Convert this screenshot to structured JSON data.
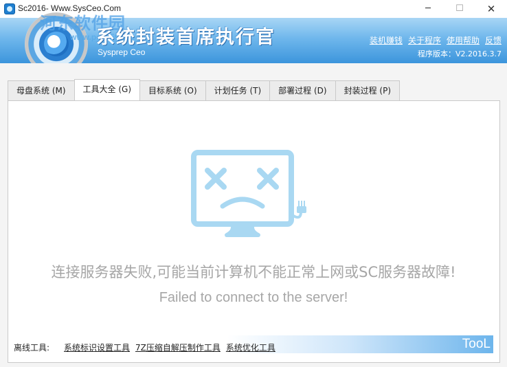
{
  "window": {
    "title": "Sc2016- Www.SysCeo.Com",
    "controls": {
      "minimize": "─",
      "maximize": "☐",
      "close": "✕"
    }
  },
  "header": {
    "watermark": "河东软件园",
    "watermark_url": "www.pc0359.cn",
    "app_name": "系统封装首席执行官",
    "app_subtitle": "Sysprep Ceo",
    "links": [
      "装机赚钱",
      "关于程序",
      "使用帮助",
      "反馈"
    ],
    "version_label": "程序版本：",
    "version_value": "V2.2016.3.7"
  },
  "tabs": [
    {
      "label": "母盘系统 (M)",
      "active": false
    },
    {
      "label": "工具大全 (G)",
      "active": true
    },
    {
      "label": "目标系统 (O)",
      "active": false
    },
    {
      "label": "计划任务 (T)",
      "active": false
    },
    {
      "label": "部署过程 (D)",
      "active": false
    },
    {
      "label": "封装过程 (P)",
      "active": false
    }
  ],
  "error": {
    "message_cn": "连接服务器失败,可能当前计算机不能正常上网或SC服务器故障!",
    "message_en": "Failed to connect to the server!",
    "icon": "broken-monitor-icon"
  },
  "footer": {
    "offline_label": "离线工具:",
    "tools": [
      "系统标识设置工具",
      "7Z压缩自解压制作工具",
      "系统优化工具"
    ],
    "badge": "TooL"
  },
  "colors": {
    "banner_top": "#a9d6f5",
    "banner_bottom": "#3c95dc",
    "illustration": "#a9d8f2",
    "error_text": "#a6a6a6"
  }
}
